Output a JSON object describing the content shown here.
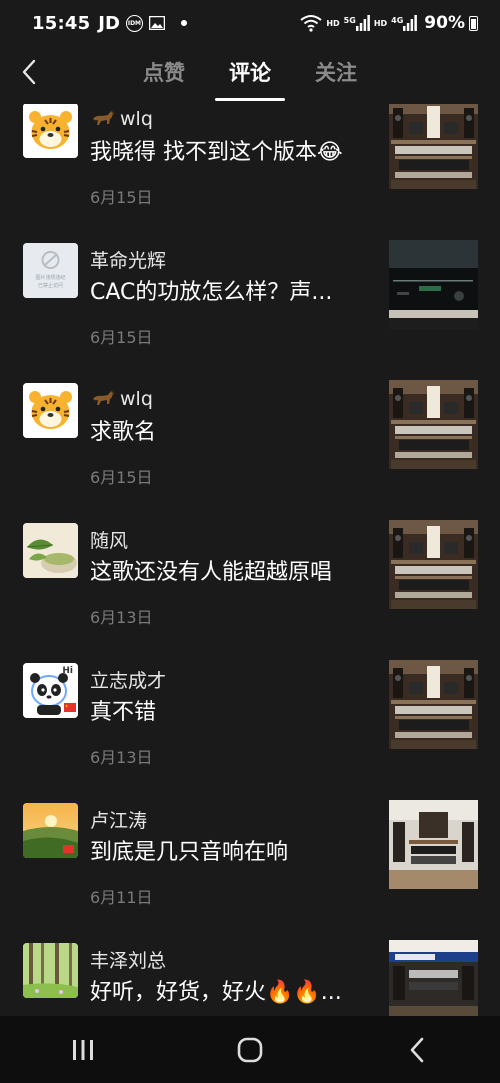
{
  "status_bar": {
    "time": "15:45",
    "carrier": "JD",
    "idm_label": "IDM",
    "hd1": "HD",
    "net1": "5G",
    "hd2": "HD",
    "net2": "4G",
    "battery": "90%"
  },
  "header": {
    "tabs": [
      {
        "label": "点赞",
        "active": false
      },
      {
        "label": "评论",
        "active": true
      },
      {
        "label": "关注",
        "active": false
      }
    ]
  },
  "comments": [
    {
      "user": "wlq",
      "has_horse_icon": true,
      "avatar": "tiger-avatar",
      "text": "我晓得 找不到这个版本",
      "emoji": "😂",
      "date": "6月15日",
      "thumb": "audio-rack-thumbnail"
    },
    {
      "user": "革命光辉",
      "has_horse_icon": false,
      "avatar": "banned-placeholder-avatar",
      "avatar_caption_1": "图片违规违纪",
      "avatar_caption_2": "已禁止访问",
      "text": "CAC的功放怎么样？声...",
      "date": "6月15日",
      "thumb": "amplifier-thumbnail"
    },
    {
      "user": "wlq",
      "has_horse_icon": true,
      "avatar": "tiger-avatar",
      "text": "求歌名",
      "date": "6月15日",
      "thumb": "audio-rack-thumbnail"
    },
    {
      "user": "随风",
      "has_horse_icon": false,
      "avatar": "tea-leaf-avatar",
      "text": "这歌还没有人能超越原唱",
      "date": "6月13日",
      "thumb": "audio-rack-thumbnail"
    },
    {
      "user": "立志成才",
      "has_horse_icon": false,
      "avatar": "panda-avatar",
      "avatar_caption_1": "Hi",
      "text": "真不错",
      "date": "6月13日",
      "thumb": "audio-rack-thumbnail"
    },
    {
      "user": "卢江涛",
      "has_horse_icon": false,
      "avatar": "sunset-field-avatar",
      "text": "到底是几只音响在响",
      "date": "6月11日",
      "thumb": "audio-room-thumbnail"
    },
    {
      "user": "丰泽刘总",
      "has_horse_icon": false,
      "avatar": "forest-avatar",
      "text": "好听，好货，好火🔥🔥...",
      "date": "",
      "thumb": "audio-shop-thumbnail"
    }
  ],
  "nav": {
    "recent": "recent-apps-icon",
    "home": "home-icon",
    "back": "back-icon"
  }
}
